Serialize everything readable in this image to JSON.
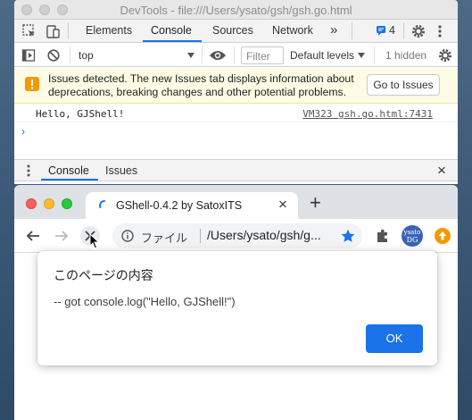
{
  "devtools": {
    "window_title": "DevTools - file:///Users/ysato/gsh/gsh.go.html",
    "tabs": [
      "Elements",
      "Console",
      "Sources",
      "Network"
    ],
    "more_tabs": "»",
    "issues_count": "4",
    "toolbar": {
      "context": "top",
      "filter_placeholder": "Filter",
      "levels": "Default levels",
      "hidden": "1 hidden"
    },
    "issues_banner": {
      "text": "Issues detected. The new Issues tab displays information about deprecations, breaking changes and other potential problems.",
      "button": "Go to Issues"
    },
    "log": {
      "message": "Hello, GJShell!",
      "source": "VM323 gsh.go.html:7431"
    },
    "prompt": "›",
    "drawer_tabs": [
      "Console",
      "Issues"
    ],
    "close": "×"
  },
  "browser": {
    "tab_title": "GShell-0.4.2 by SatoxITS",
    "tab_close": "×",
    "new_tab": "+",
    "omnibox": {
      "scheme_label": "ファイル",
      "url": "/Users/ysato/gsh/g..."
    },
    "avatar_text": [
      "ysato",
      "DG"
    ]
  },
  "alert": {
    "title": "このページの内容",
    "message": "-- got console.log(\"Hello, GJShell!\")",
    "ok": "OK"
  },
  "colors": {
    "accent": "#1a73e8",
    "warning": "#f29900"
  }
}
